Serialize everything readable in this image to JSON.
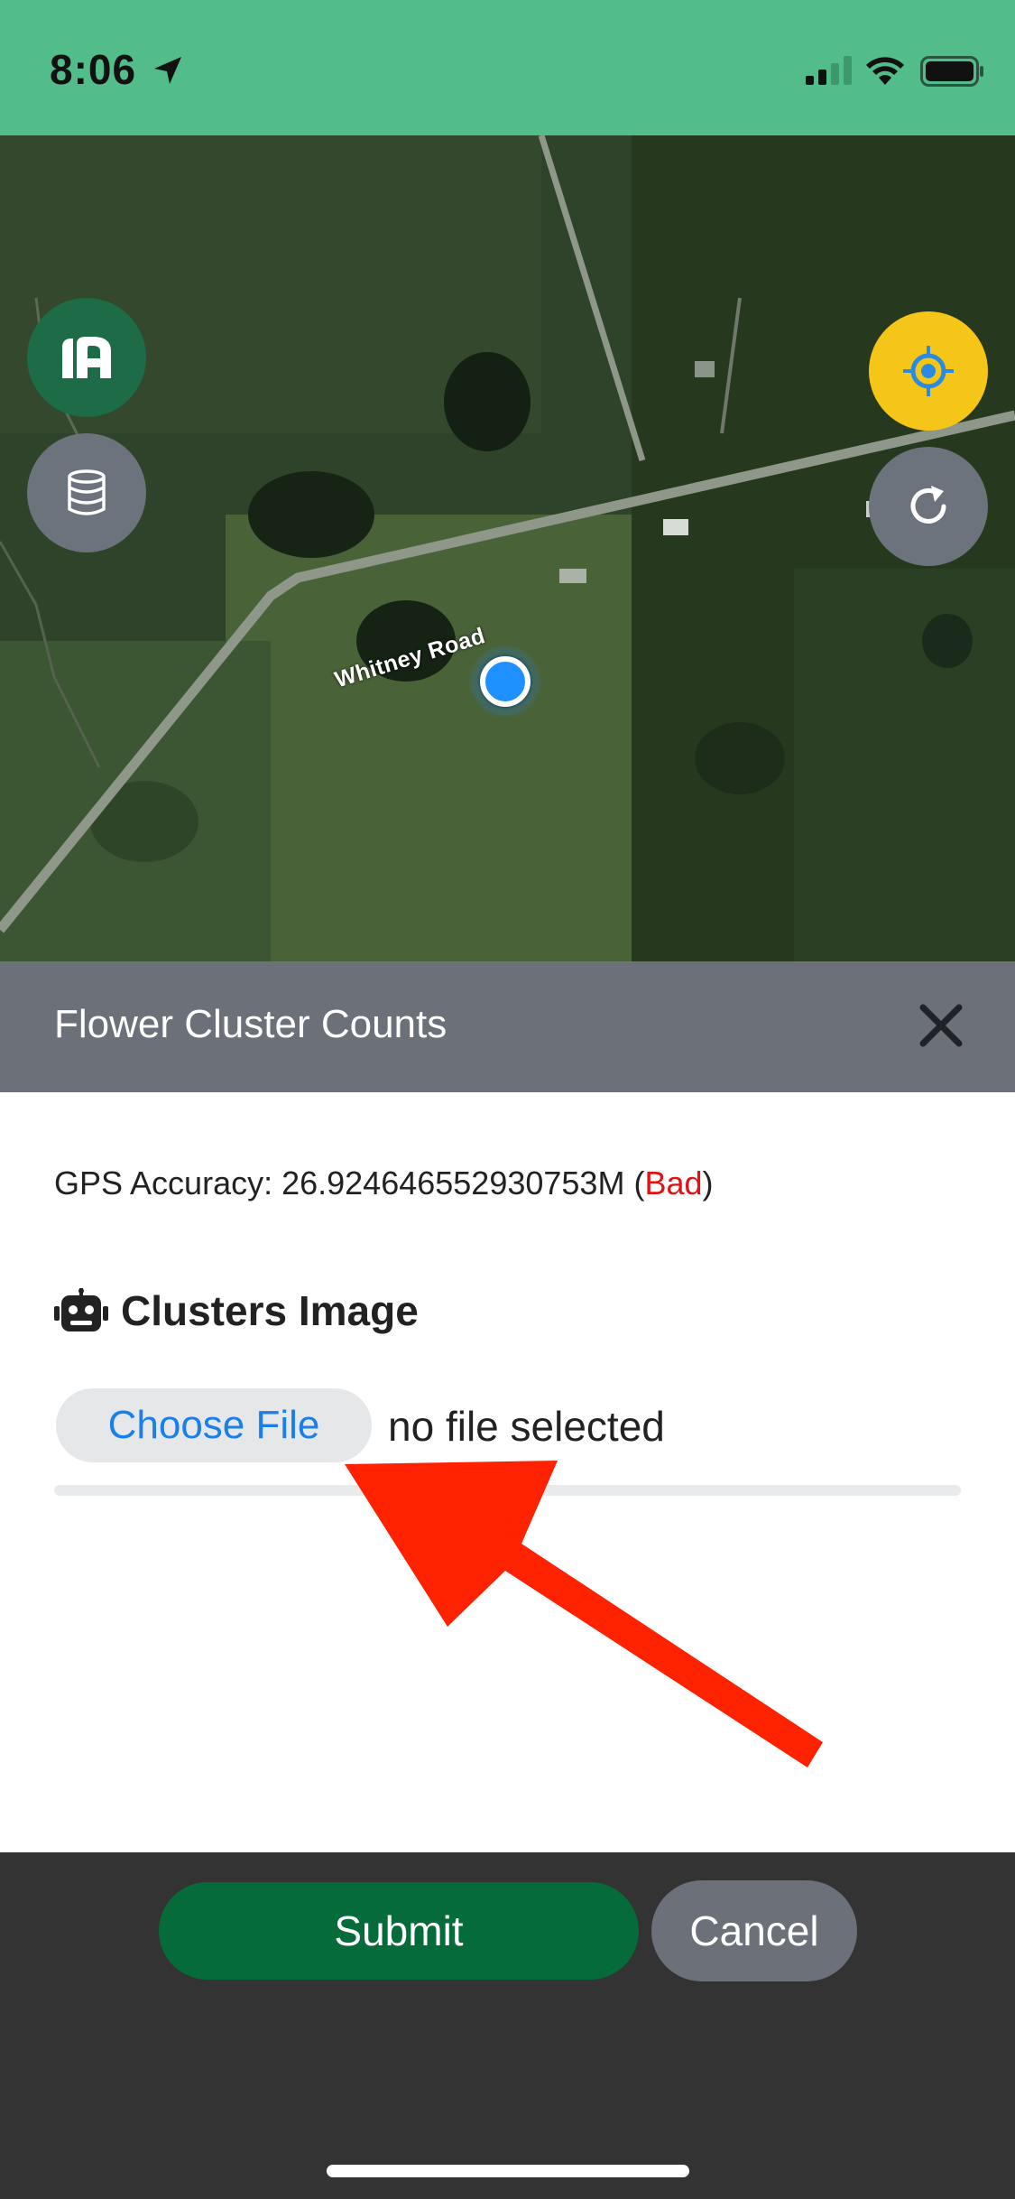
{
  "status_bar": {
    "time": "8:06",
    "icons": [
      "location-arrow-icon",
      "signal-icon",
      "wifi-icon",
      "battery-icon"
    ]
  },
  "map": {
    "road_label": "Whitney Road",
    "road_label_2": "d",
    "buttons": [
      "layers-aa-icon",
      "database-icon",
      "locate-icon",
      "refresh-icon"
    ],
    "colors": {
      "locate": "#f5c518",
      "aa_button": "#1e6b48",
      "gps_dot": "#1e90ff"
    }
  },
  "form": {
    "title": "Flower Cluster Counts",
    "gps_prefix": "GPS Accuracy: 26.924646552930753M (",
    "gps_quality": "Bad",
    "gps_suffix": ")",
    "section_title": "Clusters Image",
    "choose_file_label": "Choose File",
    "file_status": "no file selected"
  },
  "actions": {
    "submit_label": "Submit",
    "cancel_label": "Cancel"
  },
  "colors": {
    "status_bar": "#52bd8a",
    "header": "#6b7079",
    "submit": "#056b3a",
    "bad": "#e01212",
    "link_blue": "#1a7fe8",
    "annotation_arrow": "#ff2200"
  }
}
